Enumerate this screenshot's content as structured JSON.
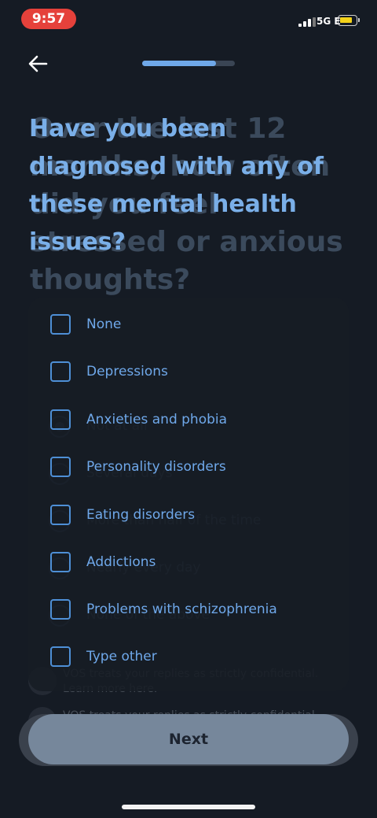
{
  "status_bar": {
    "time": "9:57",
    "network": "5G E"
  },
  "navigation": {
    "back_icon": "arrow-left-icon",
    "progress": 0.8
  },
  "question": {
    "title": "Have you been diagnosed with any of these mental health issues?"
  },
  "options": [
    {
      "label": "None",
      "checked": false
    },
    {
      "label": "Depressions",
      "checked": false
    },
    {
      "label": "Anxieties and phobia",
      "checked": false
    },
    {
      "label": "Personality disorders",
      "checked": false
    },
    {
      "label": "Eating disorders",
      "checked": false
    },
    {
      "label": "Addictions",
      "checked": false
    },
    {
      "label": "Problems with schizophrenia",
      "checked": false
    },
    {
      "label": "Type other",
      "checked": false
    }
  ],
  "ghost": {
    "title": "Over the last 12 months, how often did you feel stressed or anxious thoughts?",
    "options": [
      "Not at all",
      "Several days",
      "More than half of the time",
      "Nearly every day",
      "None of the above"
    ],
    "notice": "VOS treats your replies as strictly confidential. Learn more here.",
    "notice2": "VOS treats your replies as strictly confidential."
  },
  "footer": {
    "next_label": "Next"
  },
  "colors": {
    "accent": "#6fa8e8",
    "background": "#151b24",
    "button": "#76879b"
  }
}
